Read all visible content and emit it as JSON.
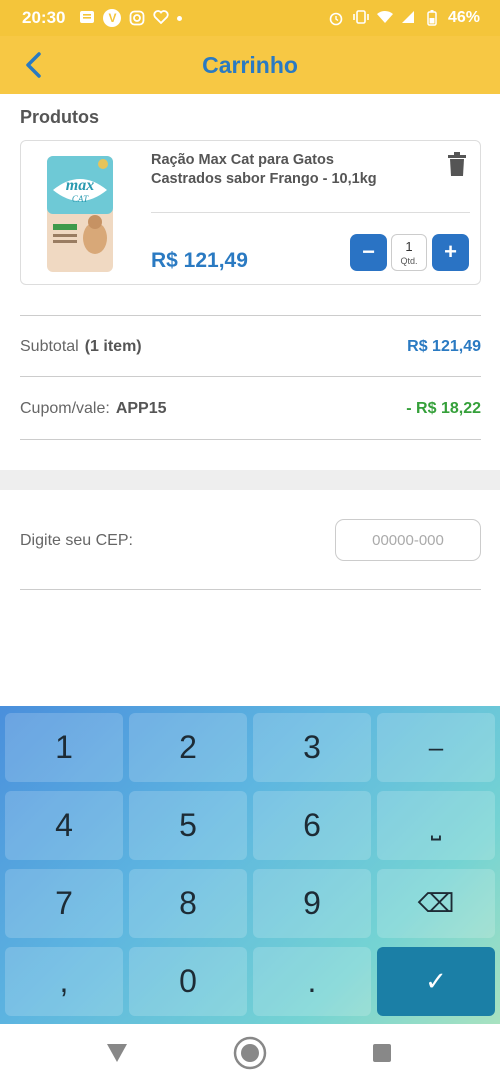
{
  "status_bar": {
    "time": "20:30",
    "battery": "46%",
    "icons": [
      "message-icon",
      "v-app-icon",
      "instagram-icon",
      "heart-app-icon",
      "dot-icon",
      "alarm-icon",
      "vibrate-icon",
      "wifi-icon",
      "signal-icon",
      "battery-icon"
    ]
  },
  "header": {
    "title": "Carrinho",
    "back_icon": "chevron-left-icon"
  },
  "products": {
    "section_title": "Produtos",
    "items": [
      {
        "name": "Ração Max Cat para Gatos Castrados sabor Frango - 10,1kg",
        "price": "R$ 121,49",
        "quantity": "1",
        "quantity_label": "Qtd.",
        "minus": "−",
        "plus": "+",
        "image": "max-cat-food-bag"
      }
    ]
  },
  "summary": {
    "subtotal_label": "Subtotal",
    "subtotal_count": "(1 item)",
    "subtotal_value": "R$ 121,49",
    "coupon_label": "Cupom/vale:",
    "coupon_code": "APP15",
    "coupon_value": "- R$ 18,22"
  },
  "cep": {
    "label": "Digite seu CEP:",
    "placeholder": "00000-000",
    "value": ""
  },
  "keyboard": {
    "keys": [
      [
        "1",
        "2",
        "3",
        "–"
      ],
      [
        "4",
        "5",
        "6",
        "⎵"
      ],
      [
        "7",
        "8",
        "9",
        "⌫"
      ],
      [
        ",",
        "0",
        ".",
        "✓"
      ]
    ]
  },
  "colors": {
    "header_bg": "#f7c844",
    "accent_blue": "#2a7ac2",
    "discount_green": "#35a03a",
    "button_blue": "#2a73c4"
  }
}
